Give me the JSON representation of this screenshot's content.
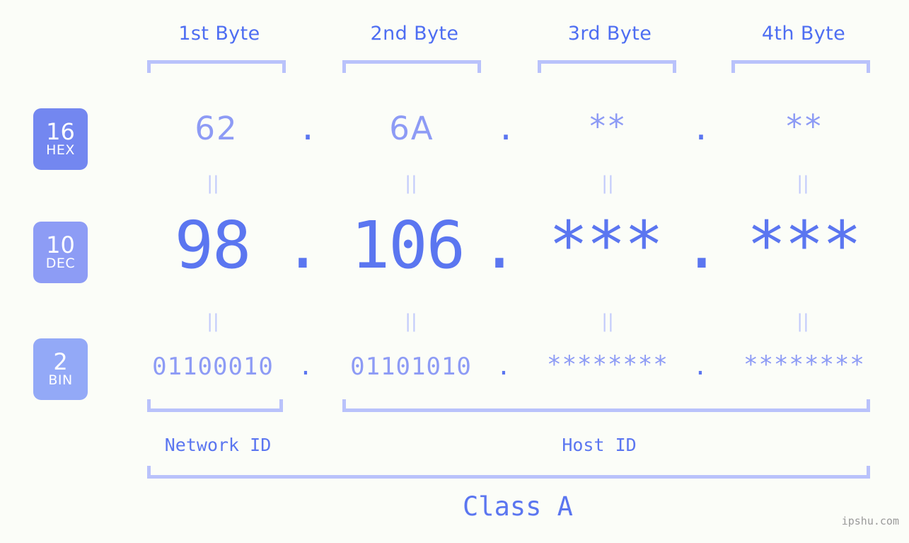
{
  "page": {
    "background_color": "#fbfdf8",
    "accent_color": "#5b76f0",
    "accent_light_color": "#8d9bf5",
    "bracket_color": "#b9c2fb",
    "watermark": "ipshu.com"
  },
  "columns": [
    {
      "label": "1st Byte"
    },
    {
      "label": "2nd Byte"
    },
    {
      "label": "3rd Byte"
    },
    {
      "label": "4th Byte"
    }
  ],
  "bases": [
    {
      "number": "16",
      "abbr": "HEX",
      "color": "#7387f0"
    },
    {
      "number": "10",
      "abbr": "DEC",
      "color": "#8d9cf5"
    },
    {
      "number": "2",
      "abbr": "BIN",
      "color": "#93a9f7"
    }
  ],
  "rows": {
    "hex": {
      "values": [
        "62",
        "6A",
        "**",
        "**"
      ],
      "separators": [
        ".",
        ".",
        "."
      ]
    },
    "dec": {
      "values": [
        "98",
        "106",
        "***",
        "***"
      ],
      "separators": [
        ".",
        ".",
        "."
      ]
    },
    "bin": {
      "values": [
        "01100010",
        "01101010",
        "********",
        "********"
      ],
      "separators": [
        ".",
        ".",
        "."
      ]
    }
  },
  "equals_separators": {
    "glyph": "||",
    "count_per_row": 4
  },
  "sections": [
    {
      "label": "Network ID"
    },
    {
      "label": "Host ID"
    }
  ],
  "class": {
    "label": "Class A"
  }
}
